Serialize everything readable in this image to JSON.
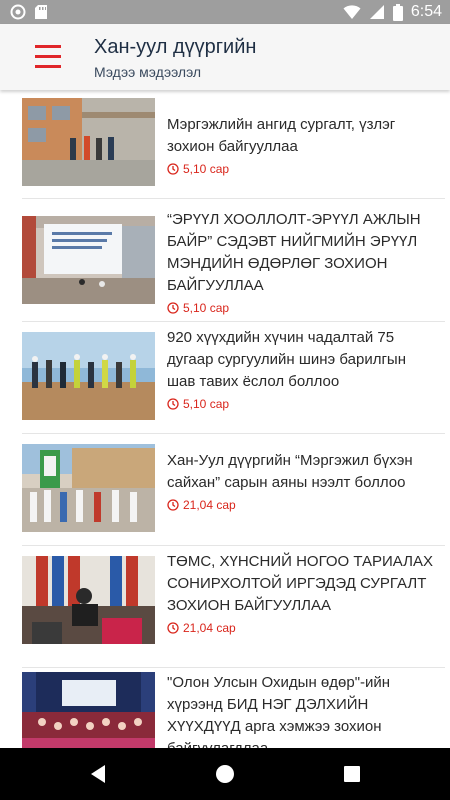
{
  "status_bar": {
    "time": "6:54",
    "icons": [
      "notification-circle-icon",
      "sd-card-icon",
      "wifi-icon",
      "cellular-signal-icon",
      "battery-icon"
    ]
  },
  "app_bar": {
    "title": "Хан-уул дүүргийн",
    "subtitle": "Мэдээ мэдээлэл",
    "menu_icon": "hamburger-menu-icon"
  },
  "accent_color": "#e0262a",
  "news": [
    {
      "title": "Мэргэжлийн ангид сургалт, үзлэг зохион байгууллаа",
      "date": "5,10 сар"
    },
    {
      "title": "“ЭРҮҮЛ ХООЛЛОЛТ-ЭРҮҮЛ АЖЛЫН БАЙР” СЭДЭВТ НИЙГМИЙН ЭРҮҮЛ МЭНДИЙН ӨДӨРЛӨГ ЗОХИОН БАЙГУУЛЛАА",
      "date": "5,10 сар"
    },
    {
      "title": "920 хүүхдийн хүчин чадалтай 75 дугаар сургуулийн шинэ барилгын шав тавих ёслол боллоо",
      "date": "5,10 сар"
    },
    {
      "title": "Хан-Уул дүүргийн “Мэргэжил бүхэн сайхан” сарын аяны нээлт боллоо",
      "date": "21,04 сар"
    },
    {
      "title": "ТӨМС, ХҮНСНИЙ НОГОО ТАРИАЛАХ СОНИРХОЛТОЙ ИРГЭДЭД СУРГАЛТ ЗОХИОН БАЙГУУЛЛАА",
      "date": "21,04 сар"
    },
    {
      "title": "\"Олон Улсын Охидын өдөр\"-ийн хүрээнд БИД НЭГ ДЭЛХИЙН ХҮҮХДҮҮД арга хэмжээ зохион байгуулагдлаа",
      "date": ""
    }
  ],
  "nav_bar": {
    "buttons": [
      "back-icon",
      "home-icon",
      "recents-icon"
    ]
  }
}
